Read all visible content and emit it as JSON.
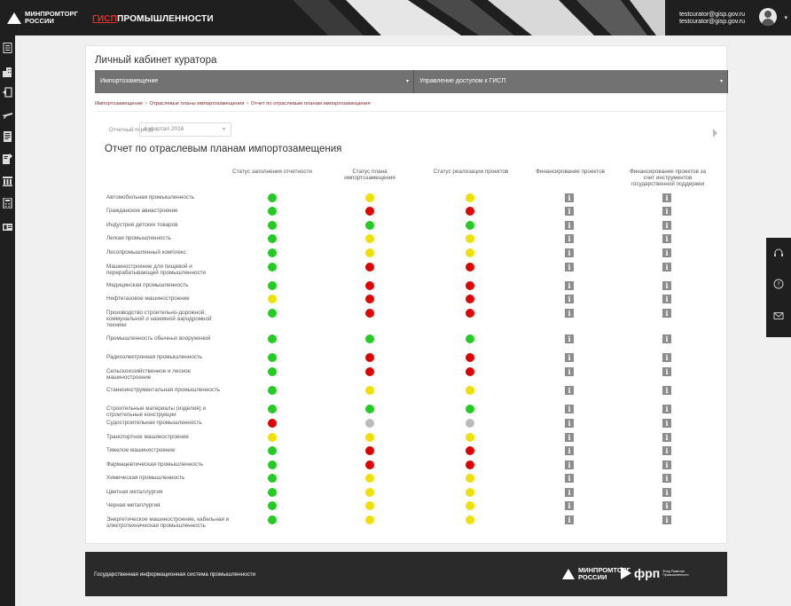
{
  "header": {
    "logo_line1": "МИНПРОМТОРГ",
    "logo_line2": "РОССИИ",
    "gisp_red": "ГИСП",
    "gisp_rest": "ПРОМЫШЛЕННОСТИ",
    "user_line1": "testcurator@gisp.gov.ru",
    "user_line2": "testcurator@gisp.gov.ru"
  },
  "sidebar": {
    "icons": [
      "report-icon",
      "building-icon",
      "import-icon",
      "plane-icon",
      "document-icon",
      "edit-document-icon",
      "table-icon",
      "calculator-icon",
      "id-card-icon"
    ]
  },
  "rightbar": {
    "icons": [
      "headset-icon",
      "help-icon",
      "mail-icon"
    ]
  },
  "page": {
    "title": "Личный кабинет куратора",
    "tabs": [
      {
        "label": "Импортозамещение"
      },
      {
        "label": "Управление доступом к ГИСП"
      }
    ],
    "breadcrumbs": [
      "Импортозамещение",
      "Отраслевые планы импортозамещения",
      "Отчет по отраслевым планам импортозамещения"
    ],
    "period_label": "Отчетный период:",
    "period_value": "4 квартал 2016",
    "report_title": "Отчет по отраслевым планам импортозамещения"
  },
  "table": {
    "columns": [
      "Статус заполнения отчетности",
      "Статус плана импортозамещения",
      "Статус реализации проектов",
      "Финансирование проектов",
      "Финансирование проектов за счет инструментов государственной поддержки"
    ],
    "colors": {
      "green": "#22cc22",
      "yellow": "#f0e000",
      "red": "#e00000",
      "gray": "#bbbbbb"
    },
    "rows": [
      {
        "label": "Автомобильная промышленность",
        "s": [
          "green",
          "yellow",
          "yellow"
        ]
      },
      {
        "label": "Гражданское авиастроение",
        "s": [
          "green",
          "red",
          "red"
        ]
      },
      {
        "label": "Индустрия детских товаров",
        "s": [
          "green",
          "green",
          "green"
        ]
      },
      {
        "label": "Легкая промышленность",
        "s": [
          "green",
          "yellow",
          "yellow"
        ]
      },
      {
        "label": "Лесопромышленный комплекс",
        "s": [
          "green",
          "yellow",
          "yellow"
        ]
      },
      {
        "label": "Машиностроение для пищевой и перерабатывающей промышленности",
        "s": [
          "green",
          "red",
          "red"
        ]
      },
      {
        "label": "Медицинская промышленность",
        "s": [
          "green",
          "red",
          "red"
        ]
      },
      {
        "label": "Нефтегазовое машиностроение",
        "s": [
          "yellow",
          "red",
          "red"
        ]
      },
      {
        "label": "Производство строительно-дорожной, коммунальной и наземной аэродромной техники",
        "s": [
          "green",
          "red",
          "red"
        ]
      },
      {
        "label": "Промышленность обычных вооружений",
        "s": [
          "green",
          "green",
          "green"
        ]
      },
      {
        "label": "Радиоэлектронная промышленность",
        "s": [
          "green",
          "red",
          "red"
        ]
      },
      {
        "label": "Сельскохозяйственное и лесное машиностроение",
        "s": [
          "green",
          "red",
          "red"
        ]
      },
      {
        "label": "Станкоинструментальная промышленность",
        "s": [
          "green",
          "yellow",
          "yellow"
        ]
      },
      {
        "label": "Строительные материалы (изделия) и строительные конструкции",
        "s": [
          "green",
          "green",
          "green"
        ]
      },
      {
        "label": "Судостроительная промышленность",
        "s": [
          "red",
          "gray",
          "gray"
        ]
      },
      {
        "label": "Транспортное машиностроение",
        "s": [
          "yellow",
          "yellow",
          "yellow"
        ]
      },
      {
        "label": "Тяжелое машиностроение",
        "s": [
          "green",
          "red",
          "red"
        ]
      },
      {
        "label": "Фармацевтическая промышленность",
        "s": [
          "green",
          "red",
          "red"
        ]
      },
      {
        "label": "Химическая промышленность",
        "s": [
          "green",
          "yellow",
          "yellow"
        ]
      },
      {
        "label": "Цветная металлургия",
        "s": [
          "green",
          "yellow",
          "yellow"
        ]
      },
      {
        "label": "Черная металлургия",
        "s": [
          "green",
          "yellow",
          "yellow"
        ]
      },
      {
        "label": "Энергетическое машиностроение, кабельная и электротехническая промышленность",
        "s": [
          "green",
          "yellow",
          "yellow"
        ]
      }
    ],
    "info_glyph": "i"
  },
  "footer": {
    "text": "Государственная информационная система промышленности",
    "logo_line1": "МИНПРОМТОРГ",
    "logo_line2": "РОССИИ",
    "frp": "фрп",
    "frp_small1": "Фонд Развития",
    "frp_small2": "Промышленности"
  }
}
